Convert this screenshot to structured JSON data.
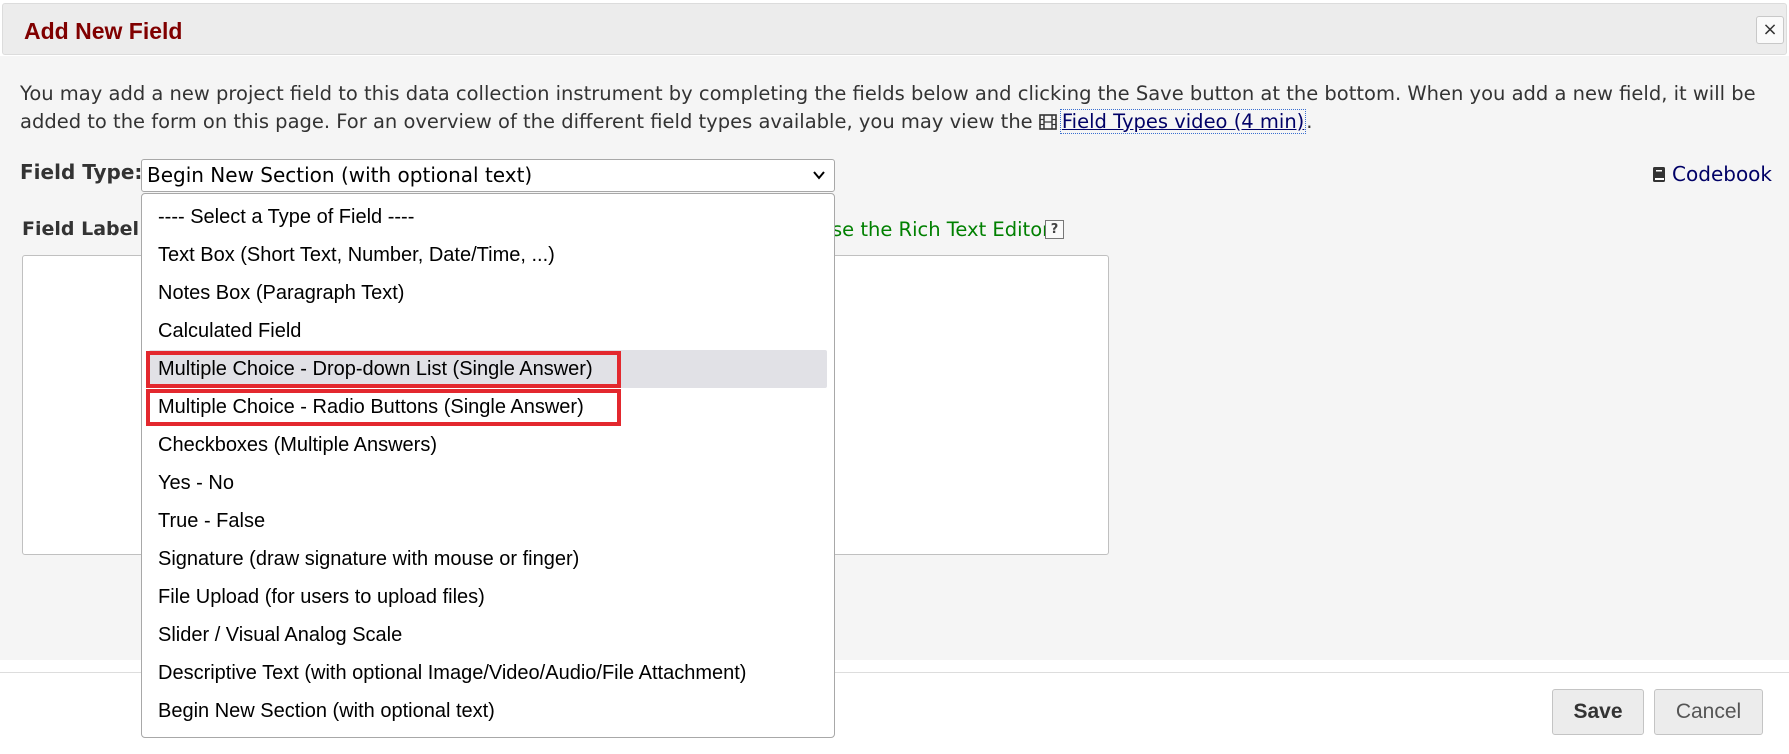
{
  "dialog": {
    "title": "Add New Field",
    "close_icon": "×"
  },
  "intro": {
    "text_before": "You may add a new project field to this data collection instrument by completing the fields below and clicking the Save button at the bottom. When you add a new field, it will be added to the form on this page. For an overview of the different field types available, you may view the ",
    "video_link": "Field Types video (4 min)",
    "text_after": "."
  },
  "field_type": {
    "label": "Field Type:",
    "selected": "Begin New Section (with optional text)",
    "chevron": "⌄"
  },
  "codebook": {
    "label": "Codebook"
  },
  "field_label": {
    "label": "Field Label",
    "rte_link": "se the Rich Text Editor",
    "help": "?"
  },
  "dropdown": {
    "options": [
      "---- Select a Type of Field ----",
      "Text Box (Short Text, Number, Date/Time, ...)",
      "Notes Box (Paragraph Text)",
      "Calculated Field",
      "Multiple Choice - Drop-down List (Single Answer)",
      "Multiple Choice - Radio Buttons (Single Answer)",
      "Checkboxes (Multiple Answers)",
      "Yes - No",
      "True - False",
      "Signature (draw signature with mouse or finger)",
      "File Upload (for users to upload files)",
      "Slider / Visual Analog Scale",
      "Descriptive Text (with optional Image/Video/Audio/File Attachment)",
      "Begin New Section (with optional text)"
    ],
    "hovered_index": 4,
    "highlighted_indices": [
      4,
      5
    ],
    "highlight_color": "#e3282e"
  },
  "buttons": {
    "save": "Save",
    "cancel": "Cancel"
  },
  "colors": {
    "title": "#800000",
    "link": "#000066",
    "rte_link": "#008000"
  }
}
